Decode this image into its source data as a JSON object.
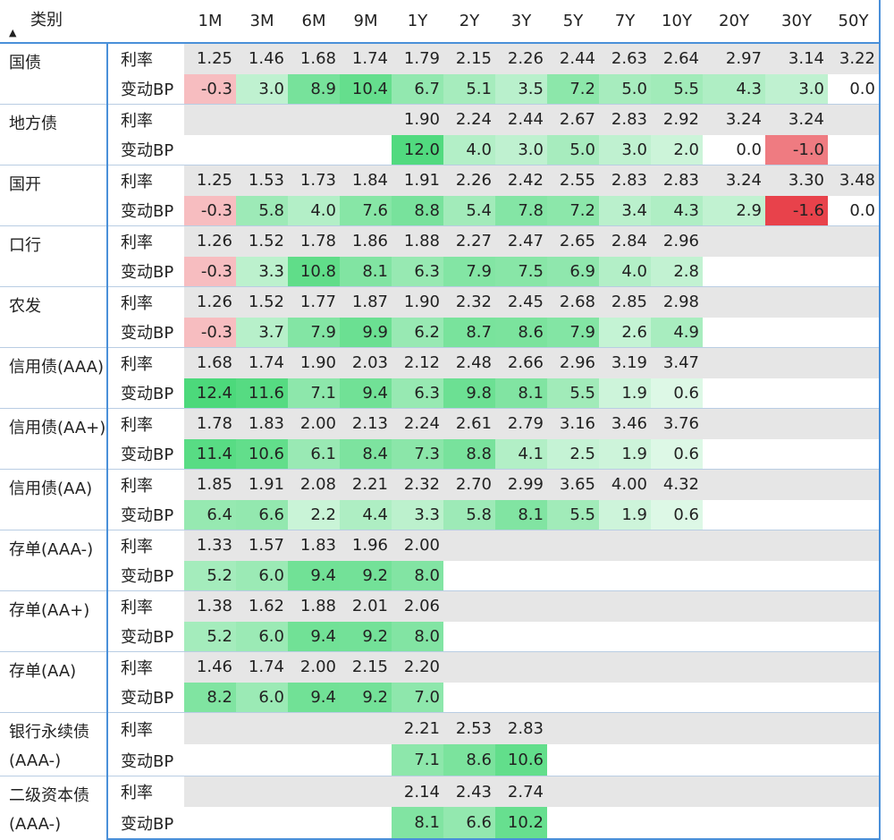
{
  "header": {
    "category_label": "类别",
    "tenors": [
      "1M",
      "3M",
      "6M",
      "9M",
      "1Y",
      "2Y",
      "3Y",
      "5Y",
      "7Y",
      "10Y",
      "20Y",
      "30Y",
      "50Y"
    ]
  },
  "colors": {
    "rate_bg": "#e6e6e6",
    "positive": "#4cd97b",
    "negative": "#e8424b",
    "border": "#4a90d9"
  },
  "chart_data": {
    "type": "table",
    "columns": [
      "1M",
      "3M",
      "6M",
      "9M",
      "1Y",
      "2Y",
      "3Y",
      "5Y",
      "7Y",
      "10Y",
      "20Y",
      "30Y",
      "50Y"
    ],
    "row_labels": [
      "利率",
      "变动BP"
    ],
    "groups": [
      {
        "name": "国债",
        "rate": [
          "1.25",
          "1.46",
          "1.68",
          "1.74",
          "1.79",
          "2.15",
          "2.26",
          "2.44",
          "2.63",
          "2.64",
          "2.97",
          "3.14",
          "3.22"
        ],
        "change": [
          "-0.3",
          "3.0",
          "8.9",
          "10.4",
          "6.7",
          "5.1",
          "3.5",
          "7.2",
          "5.0",
          "5.5",
          "4.3",
          "3.0",
          "0.0"
        ]
      },
      {
        "name": "地方债",
        "rate": [
          "",
          "",
          "",
          "",
          "1.90",
          "2.24",
          "2.44",
          "2.67",
          "2.83",
          "2.92",
          "3.24",
          "3.24",
          ""
        ],
        "change": [
          "",
          "",
          "",
          "",
          "12.0",
          "4.0",
          "3.0",
          "5.0",
          "3.0",
          "2.0",
          "0.0",
          "-1.0",
          ""
        ]
      },
      {
        "name": "国开",
        "rate": [
          "1.25",
          "1.53",
          "1.73",
          "1.84",
          "1.91",
          "2.26",
          "2.42",
          "2.55",
          "2.83",
          "2.83",
          "3.24",
          "3.30",
          "3.48"
        ],
        "change": [
          "-0.3",
          "5.8",
          "4.0",
          "7.6",
          "8.8",
          "5.4",
          "7.8",
          "7.2",
          "3.4",
          "4.3",
          "2.9",
          "-1.6",
          "0.0"
        ]
      },
      {
        "name": "口行",
        "rate": [
          "1.26",
          "1.52",
          "1.78",
          "1.86",
          "1.88",
          "2.27",
          "2.47",
          "2.65",
          "2.84",
          "2.96",
          "",
          "",
          ""
        ],
        "change": [
          "-0.3",
          "3.3",
          "10.8",
          "8.1",
          "6.3",
          "7.9",
          "7.5",
          "6.9",
          "4.0",
          "2.8",
          "",
          "",
          ""
        ]
      },
      {
        "name": "农发",
        "rate": [
          "1.26",
          "1.52",
          "1.77",
          "1.87",
          "1.90",
          "2.32",
          "2.45",
          "2.68",
          "2.85",
          "2.98",
          "",
          "",
          ""
        ],
        "change": [
          "-0.3",
          "3.7",
          "7.9",
          "9.9",
          "6.2",
          "8.7",
          "8.6",
          "7.9",
          "2.6",
          "4.9",
          "",
          "",
          ""
        ]
      },
      {
        "name": "信用债(AAA)",
        "rate": [
          "1.68",
          "1.74",
          "1.90",
          "2.03",
          "2.12",
          "2.48",
          "2.66",
          "2.96",
          "3.19",
          "3.47",
          "",
          "",
          ""
        ],
        "change": [
          "12.4",
          "11.6",
          "7.1",
          "9.4",
          "6.3",
          "9.8",
          "8.1",
          "5.5",
          "1.9",
          "0.6",
          "",
          "",
          ""
        ]
      },
      {
        "name": "信用债(AA+)",
        "rate": [
          "1.78",
          "1.83",
          "2.00",
          "2.13",
          "2.24",
          "2.61",
          "2.79",
          "3.16",
          "3.46",
          "3.76",
          "",
          "",
          ""
        ],
        "change": [
          "11.4",
          "10.6",
          "6.1",
          "8.4",
          "7.3",
          "8.8",
          "4.1",
          "2.5",
          "1.9",
          "0.6",
          "",
          "",
          ""
        ]
      },
      {
        "name": "信用债(AA)",
        "rate": [
          "1.85",
          "1.91",
          "2.08",
          "2.21",
          "2.32",
          "2.70",
          "2.99",
          "3.65",
          "4.00",
          "4.32",
          "",
          "",
          ""
        ],
        "change": [
          "6.4",
          "6.6",
          "2.2",
          "4.4",
          "3.3",
          "5.8",
          "8.1",
          "5.5",
          "1.9",
          "0.6",
          "",
          "",
          ""
        ]
      },
      {
        "name": "存单(AAA-)",
        "rate": [
          "1.33",
          "1.57",
          "1.83",
          "1.96",
          "2.00",
          "",
          "",
          "",
          "",
          "",
          "",
          "",
          ""
        ],
        "change": [
          "5.2",
          "6.0",
          "9.4",
          "9.2",
          "8.0",
          "",
          "",
          "",
          "",
          "",
          "",
          "",
          ""
        ]
      },
      {
        "name": "存单(AA+)",
        "rate": [
          "1.38",
          "1.62",
          "1.88",
          "2.01",
          "2.06",
          "",
          "",
          "",
          "",
          "",
          "",
          "",
          ""
        ],
        "change": [
          "5.2",
          "6.0",
          "9.4",
          "9.2",
          "8.0",
          "",
          "",
          "",
          "",
          "",
          "",
          "",
          ""
        ]
      },
      {
        "name": "存单(AA)",
        "rate": [
          "1.46",
          "1.74",
          "2.00",
          "2.15",
          "2.20",
          "",
          "",
          "",
          "",
          "",
          "",
          "",
          ""
        ],
        "change": [
          "8.2",
          "6.0",
          "9.4",
          "9.2",
          "7.0",
          "",
          "",
          "",
          "",
          "",
          "",
          "",
          ""
        ]
      },
      {
        "name": "银行永续债(AAA-)",
        "rate": [
          "",
          "",
          "",
          "",
          "2.21",
          "2.53",
          "2.83",
          "",
          "",
          "",
          "",
          "",
          ""
        ],
        "change": [
          "",
          "",
          "",
          "",
          "7.1",
          "8.6",
          "10.6",
          "",
          "",
          "",
          "",
          "",
          ""
        ]
      },
      {
        "name": "二级资本债(AAA-)",
        "rate": [
          "",
          "",
          "",
          "",
          "2.14",
          "2.43",
          "2.74",
          "",
          "",
          "",
          "",
          "",
          ""
        ],
        "change": [
          "",
          "",
          "",
          "",
          "8.1",
          "6.6",
          "10.2",
          "",
          "",
          "",
          "",
          "",
          ""
        ]
      }
    ]
  }
}
